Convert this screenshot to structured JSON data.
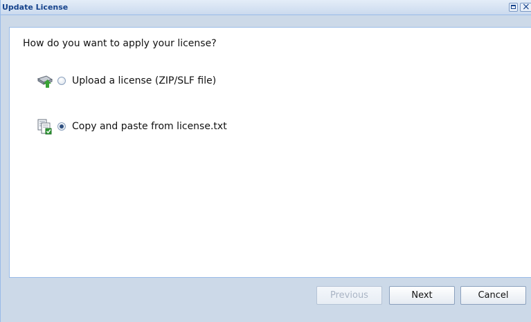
{
  "window": {
    "title": "Update License"
  },
  "content": {
    "question": "How do you want to apply your license?",
    "options": [
      {
        "label": "Upload a license (ZIP/SLF file)",
        "icon": "upload-drive-icon",
        "checked": false
      },
      {
        "label": "Copy and paste from license.txt",
        "icon": "paste-document-icon",
        "checked": true
      }
    ]
  },
  "footer": {
    "previous_label": "Previous",
    "next_label": "Next",
    "cancel_label": "Cancel"
  },
  "colors": {
    "title_text": "#15428b",
    "frame_border": "#99bbe8",
    "window_background": "#ccd9e8",
    "panel_background": "#ffffff"
  }
}
